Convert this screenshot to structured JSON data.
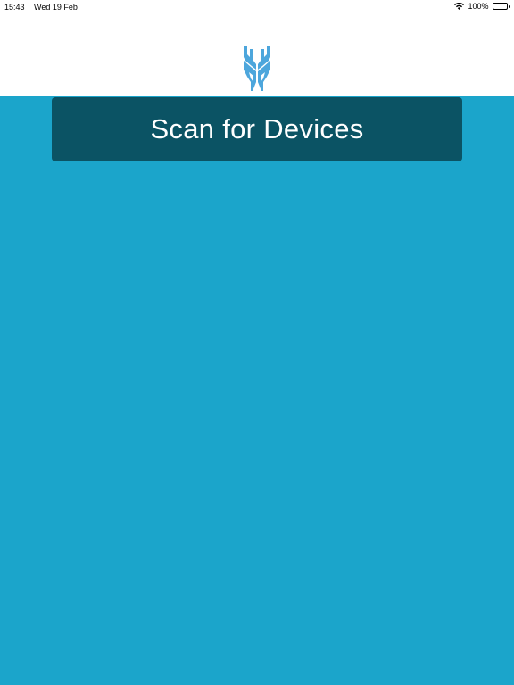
{
  "status_bar": {
    "time": "15:43",
    "date": "Wed 19 Feb",
    "battery": "100%",
    "wifi_icon": "wifi-icon",
    "battery_icon": "battery-full-icon"
  },
  "header": {
    "logo_icon": "stag-head-logo-icon"
  },
  "main": {
    "scan_button_label": "Scan for Devices"
  },
  "colors": {
    "background": "#1ba5cb",
    "button": "#0b5364",
    "logo": "#4da6dc",
    "header": "#ffffff"
  }
}
